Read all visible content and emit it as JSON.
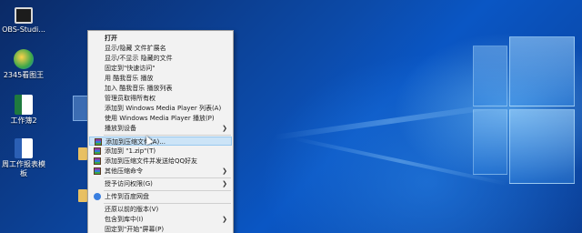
{
  "desktop": {
    "icons": [
      {
        "label": "OBS-Studi..."
      },
      {
        "label": "2345看图王"
      },
      {
        "label": "工作簿2"
      },
      {
        "label": "周工作报表模板"
      }
    ]
  },
  "context_menu": {
    "items": [
      {
        "label": "打开",
        "bold": true
      },
      {
        "label": "显示/隐藏 文件扩展名"
      },
      {
        "label": "显示/不显示 隐藏的文件"
      },
      {
        "label": "固定到\"快速访问\""
      },
      {
        "label": "用 酷我音乐 播放"
      },
      {
        "label": "加入 酷我音乐 播放列表"
      },
      {
        "label": "管理员取得所有权"
      },
      {
        "label": "添加到 Windows Media Player 列表(A)"
      },
      {
        "label": "使用 Windows Media Player 播放(P)"
      },
      {
        "label": "播放到设备"
      },
      {
        "label": "添加到压缩文件(A)..."
      },
      {
        "label": "添加到 \"1.zip\"(T)"
      },
      {
        "label": "添加到压缩文件并发送给QQ好友"
      },
      {
        "label": "其他压缩命令"
      },
      {
        "label": "授予访问权限(G)"
      },
      {
        "label": "上传到百度网盘"
      },
      {
        "label": "还原以前的版本(V)"
      },
      {
        "label": "包含到库中(I)"
      },
      {
        "label": "固定到\"开始\"屏幕(P)"
      }
    ]
  },
  "colors": {
    "menu_highlight": "#cce4f7",
    "menu_background": "#f2f2f2",
    "desktop_blue": "#0c4aa8"
  }
}
